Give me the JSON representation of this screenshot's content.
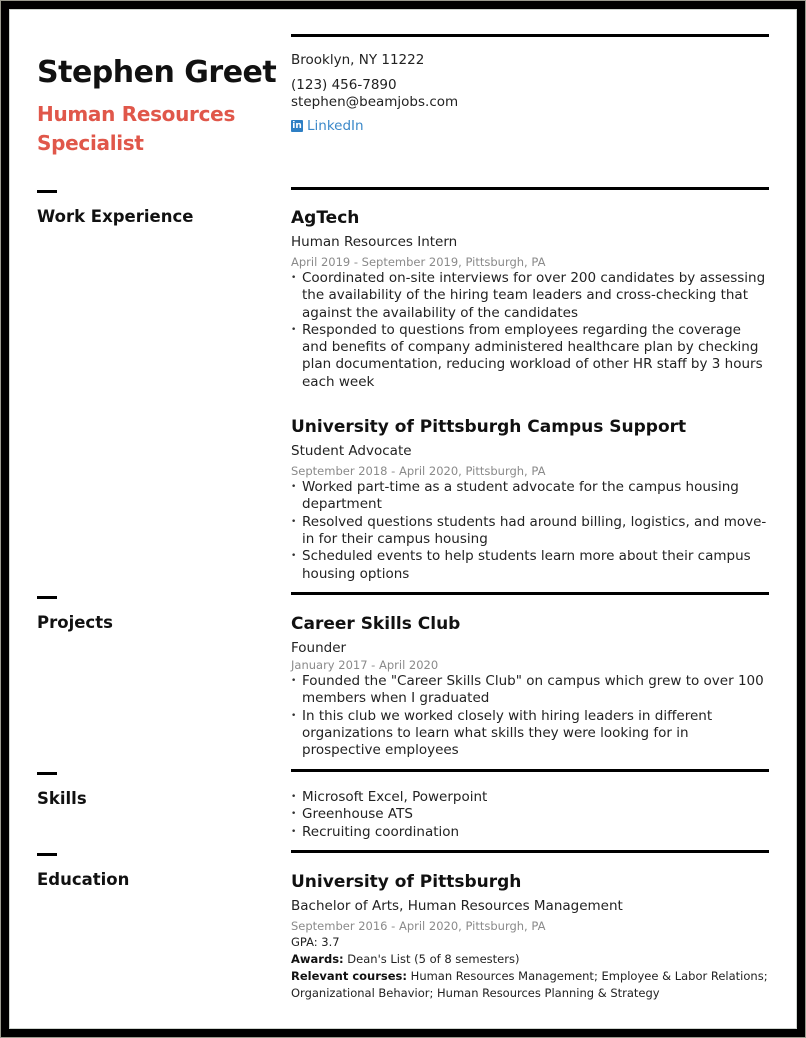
{
  "header": {
    "name": "Stephen Greet",
    "title_line1": "Human Resources",
    "title_line2": "Specialist",
    "accent_color": "#e0574a"
  },
  "contact": {
    "address": "Brooklyn, NY 11222",
    "phone": "(123) 456-7890",
    "email": "stephen@beamjobs.com",
    "linkedin_icon": "in",
    "linkedin_label": "LinkedIn"
  },
  "sections": {
    "work_label": "Work Experience",
    "projects_label": "Projects",
    "skills_label": "Skills",
    "education_label": "Education"
  },
  "work": [
    {
      "org": "AgTech",
      "role": "Human Resources Intern",
      "dates": "April 2019 - September 2019",
      "location": "Pittsburgh, PA",
      "bullets": [
        "Coordinated on-site interviews for over 200 candidates by assessing the availability of the hiring team leaders and cross-checking that against the availability of the candidates",
        "Responded to questions from employees regarding the coverage and benefits of company administered healthcare plan by checking plan documentation, reducing workload of other HR staff by 3 hours each week"
      ]
    },
    {
      "org": "University of Pittsburgh Campus Support",
      "role": "Student Advocate",
      "dates": "September 2018 - April 2020",
      "location": "Pittsburgh, PA",
      "bullets": [
        "Worked part-time as a student advocate for the campus housing department",
        "Resolved questions students had around billing, logistics, and move-in for their campus housing",
        "Scheduled events to help students learn more about their campus housing options"
      ]
    }
  ],
  "projects": [
    {
      "org": "Career Skills Club",
      "role": "Founder",
      "dates": "January 2017 - April 2020",
      "bullets": [
        "Founded the \"Career Skills Club\" on campus which grew to over 100 members when I graduated",
        "In this club we worked closely with hiring leaders in different organizations to learn what skills they were looking for in prospective employees"
      ]
    }
  ],
  "skills": [
    "Microsoft Excel, Powerpoint",
    "Greenhouse ATS",
    "Recruiting coordination"
  ],
  "education": {
    "school": "University of Pittsburgh",
    "degree_type": "Bachelor of Arts",
    "degree_field": "Human Resources Management",
    "dates": "September 2016 - April 2020",
    "location": "Pittsburgh, PA",
    "gpa": "GPA: 3.7",
    "awards_label": "Awards:",
    "awards": "Dean's List (5 of 8 semesters)",
    "courses_label": "Relevant courses:",
    "courses": "Human Resources Management; Employee & Labor Relations; Organizational Behavior; Human Resources Planning & Strategy"
  }
}
